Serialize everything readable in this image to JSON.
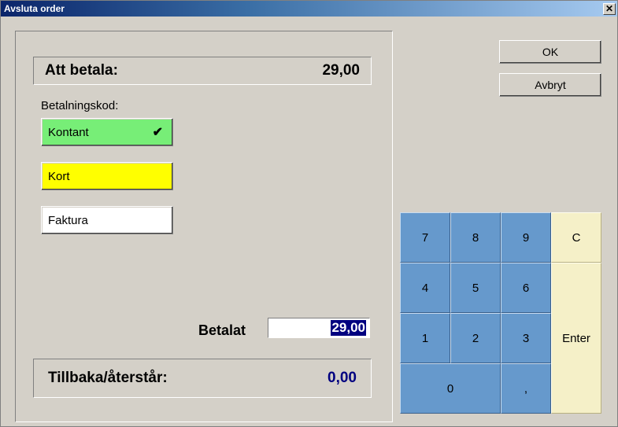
{
  "window": {
    "title": "Avsluta order"
  },
  "header": {
    "label": "Att betala:",
    "amount": "29,00"
  },
  "paymentcode_label": "Betalningskod:",
  "payments": {
    "kontant": "Kontant",
    "kort": "Kort",
    "faktura": "Faktura"
  },
  "paid": {
    "label": "Betalat",
    "value": "29,00"
  },
  "change": {
    "label": "Tillbaka/återstår:",
    "value": "0,00"
  },
  "buttons": {
    "ok": "OK",
    "cancel": "Avbryt"
  },
  "keypad": {
    "k7": "7",
    "k8": "8",
    "k9": "9",
    "c": "C",
    "k4": "4",
    "k5": "5",
    "k6": "6",
    "k1": "1",
    "k2": "2",
    "k3": "3",
    "k0": "0",
    "comma": ",",
    "enter": "Enter"
  },
  "colors": {
    "kontant": "#77ee77",
    "kort": "#ffff00",
    "faktura": "#ffffff",
    "keypad_blue": "#6699cc",
    "keypad_cream": "#f5f0c8",
    "accent_text": "#000080"
  }
}
